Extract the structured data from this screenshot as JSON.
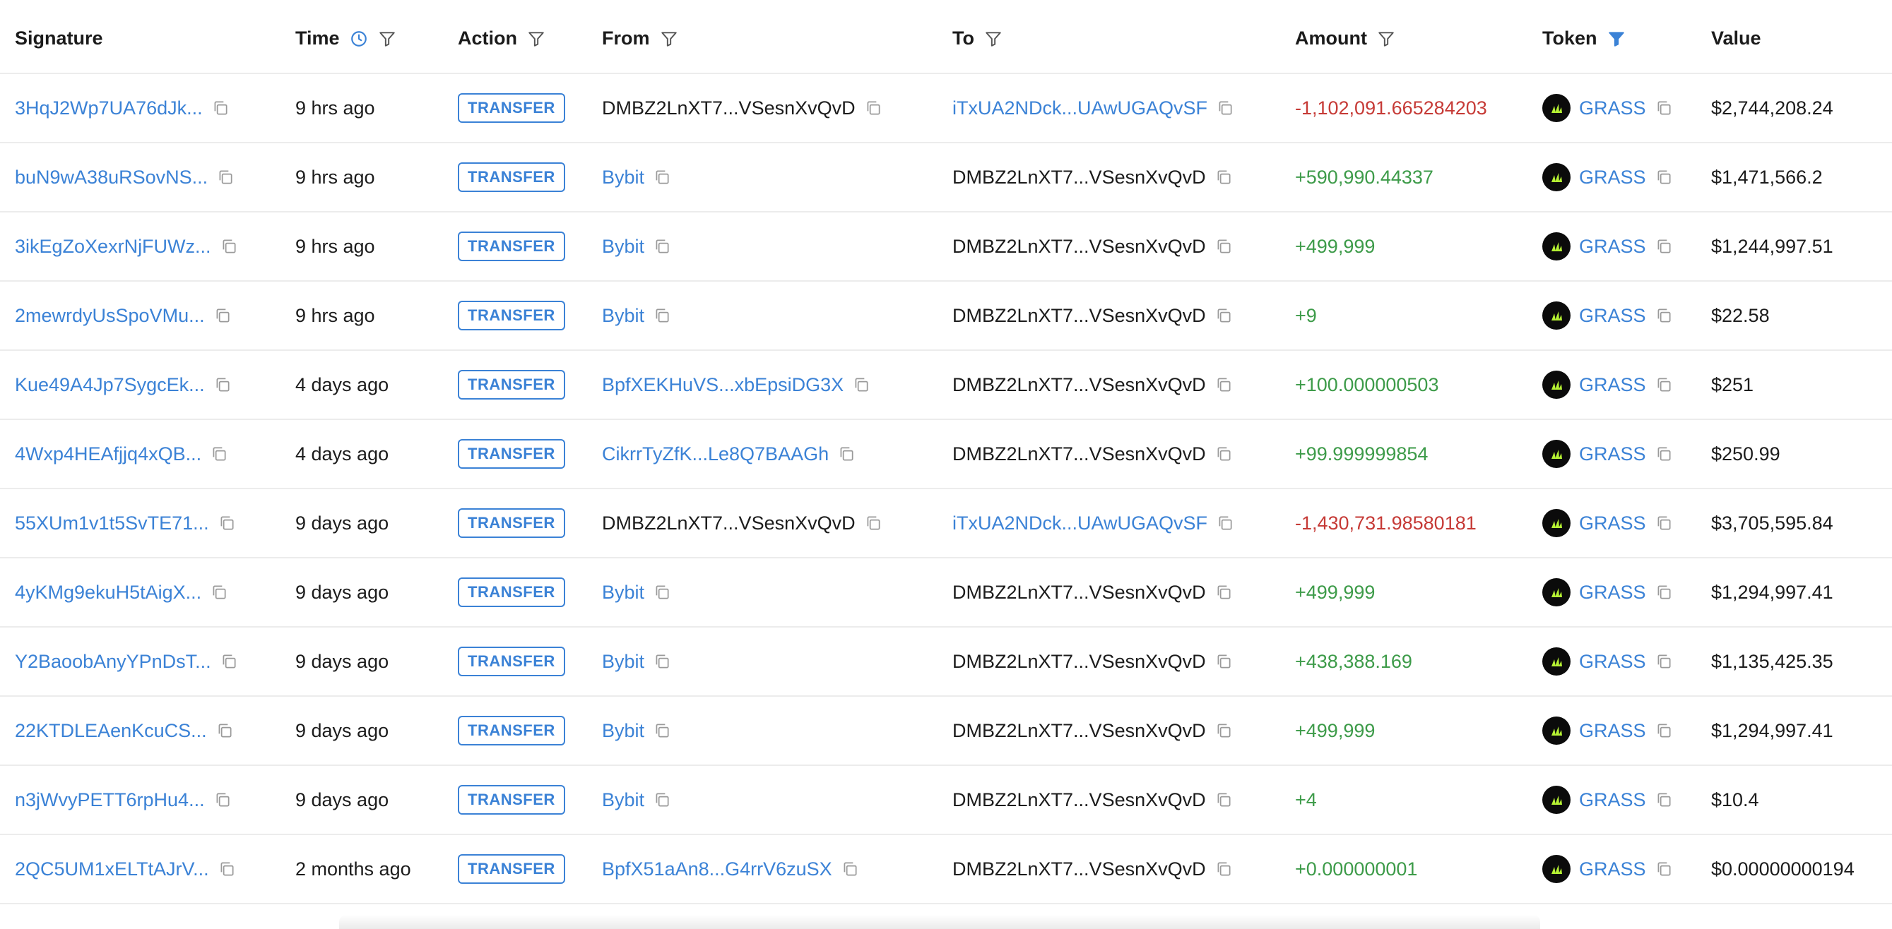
{
  "headers": {
    "signature": "Signature",
    "time": "Time",
    "action": "Action",
    "from": "From",
    "to": "To",
    "amount": "Amount",
    "token": "Token",
    "value": "Value"
  },
  "colors": {
    "link": "#3b82d6",
    "positive": "#3d9b49",
    "negative": "#c63a36",
    "token_logo_bg": "#0b0b0b",
    "token_logo_fg": "#b6f233"
  },
  "icons": {
    "time_header": "clock-icon",
    "filter": "filter-icon",
    "filter_active": "filter-filled-icon",
    "copy": "copy-icon",
    "token_logo": "grass-token-logo"
  },
  "rows": [
    {
      "signature": "3HqJ2Wp7UA76dJk...",
      "time": "9 hrs ago",
      "action": "TRANSFER",
      "from": "DMBZ2LnXT7...VSesnXvQvD",
      "from_link": false,
      "to": "iTxUA2NDck...UAwUGAQvSF",
      "to_link": true,
      "amount": "-1,102,091.665284203",
      "amount_sign": "neg",
      "token": "GRASS",
      "value": "$2,744,208.24"
    },
    {
      "signature": "buN9wA38uRSovNS...",
      "time": "9 hrs ago",
      "action": "TRANSFER",
      "from": "Bybit",
      "from_link": true,
      "to": "DMBZ2LnXT7...VSesnXvQvD",
      "to_link": false,
      "amount": "+590,990.44337",
      "amount_sign": "pos",
      "token": "GRASS",
      "value": "$1,471,566.2"
    },
    {
      "signature": "3ikEgZoXexrNjFUWz...",
      "time": "9 hrs ago",
      "action": "TRANSFER",
      "from": "Bybit",
      "from_link": true,
      "to": "DMBZ2LnXT7...VSesnXvQvD",
      "to_link": false,
      "amount": "+499,999",
      "amount_sign": "pos",
      "token": "GRASS",
      "value": "$1,244,997.51"
    },
    {
      "signature": "2mewrdyUsSpoVMu...",
      "time": "9 hrs ago",
      "action": "TRANSFER",
      "from": "Bybit",
      "from_link": true,
      "to": "DMBZ2LnXT7...VSesnXvQvD",
      "to_link": false,
      "amount": "+9",
      "amount_sign": "pos",
      "token": "GRASS",
      "value": "$22.58"
    },
    {
      "signature": "Kue49A4Jp7SygcEk...",
      "time": "4 days ago",
      "action": "TRANSFER",
      "from": "BpfXEKHuVS...xbEpsiDG3X",
      "from_link": true,
      "to": "DMBZ2LnXT7...VSesnXvQvD",
      "to_link": false,
      "amount": "+100.000000503",
      "amount_sign": "pos",
      "token": "GRASS",
      "value": "$251"
    },
    {
      "signature": "4Wxp4HEAfjjq4xQB...",
      "time": "4 days ago",
      "action": "TRANSFER",
      "from": "CikrrTyZfK...Le8Q7BAAGh",
      "from_link": true,
      "to": "DMBZ2LnXT7...VSesnXvQvD",
      "to_link": false,
      "amount": "+99.999999854",
      "amount_sign": "pos",
      "token": "GRASS",
      "value": "$250.99"
    },
    {
      "signature": "55XUm1v1t5SvTE71...",
      "time": "9 days ago",
      "action": "TRANSFER",
      "from": "DMBZ2LnXT7...VSesnXvQvD",
      "from_link": false,
      "to": "iTxUA2NDck...UAwUGAQvSF",
      "to_link": true,
      "amount": "-1,430,731.98580181",
      "amount_sign": "neg",
      "token": "GRASS",
      "value": "$3,705,595.84"
    },
    {
      "signature": "4yKMg9ekuH5tAigX...",
      "time": "9 days ago",
      "action": "TRANSFER",
      "from": "Bybit",
      "from_link": true,
      "to": "DMBZ2LnXT7...VSesnXvQvD",
      "to_link": false,
      "amount": "+499,999",
      "amount_sign": "pos",
      "token": "GRASS",
      "value": "$1,294,997.41"
    },
    {
      "signature": "Y2BaoobAnyYPnDsT...",
      "time": "9 days ago",
      "action": "TRANSFER",
      "from": "Bybit",
      "from_link": true,
      "to": "DMBZ2LnXT7...VSesnXvQvD",
      "to_link": false,
      "amount": "+438,388.169",
      "amount_sign": "pos",
      "token": "GRASS",
      "value": "$1,135,425.35"
    },
    {
      "signature": "22KTDLEAenKcuCS...",
      "time": "9 days ago",
      "action": "TRANSFER",
      "from": "Bybit",
      "from_link": true,
      "to": "DMBZ2LnXT7...VSesnXvQvD",
      "to_link": false,
      "amount": "+499,999",
      "amount_sign": "pos",
      "token": "GRASS",
      "value": "$1,294,997.41"
    },
    {
      "signature": "n3jWvyPETT6rpHu4...",
      "time": "9 days ago",
      "action": "TRANSFER",
      "from": "Bybit",
      "from_link": true,
      "to": "DMBZ2LnXT7...VSesnXvQvD",
      "to_link": false,
      "amount": "+4",
      "amount_sign": "pos",
      "token": "GRASS",
      "value": "$10.4"
    },
    {
      "signature": "2QC5UM1xELTtAJrV...",
      "time": "2 months ago",
      "action": "TRANSFER",
      "from": "BpfX51aAn8...G4rrV6zuSX",
      "from_link": true,
      "to": "DMBZ2LnXT7...VSesnXvQvD",
      "to_link": false,
      "amount": "+0.000000001",
      "amount_sign": "pos",
      "token": "GRASS",
      "value": "$0.00000000194"
    }
  ]
}
